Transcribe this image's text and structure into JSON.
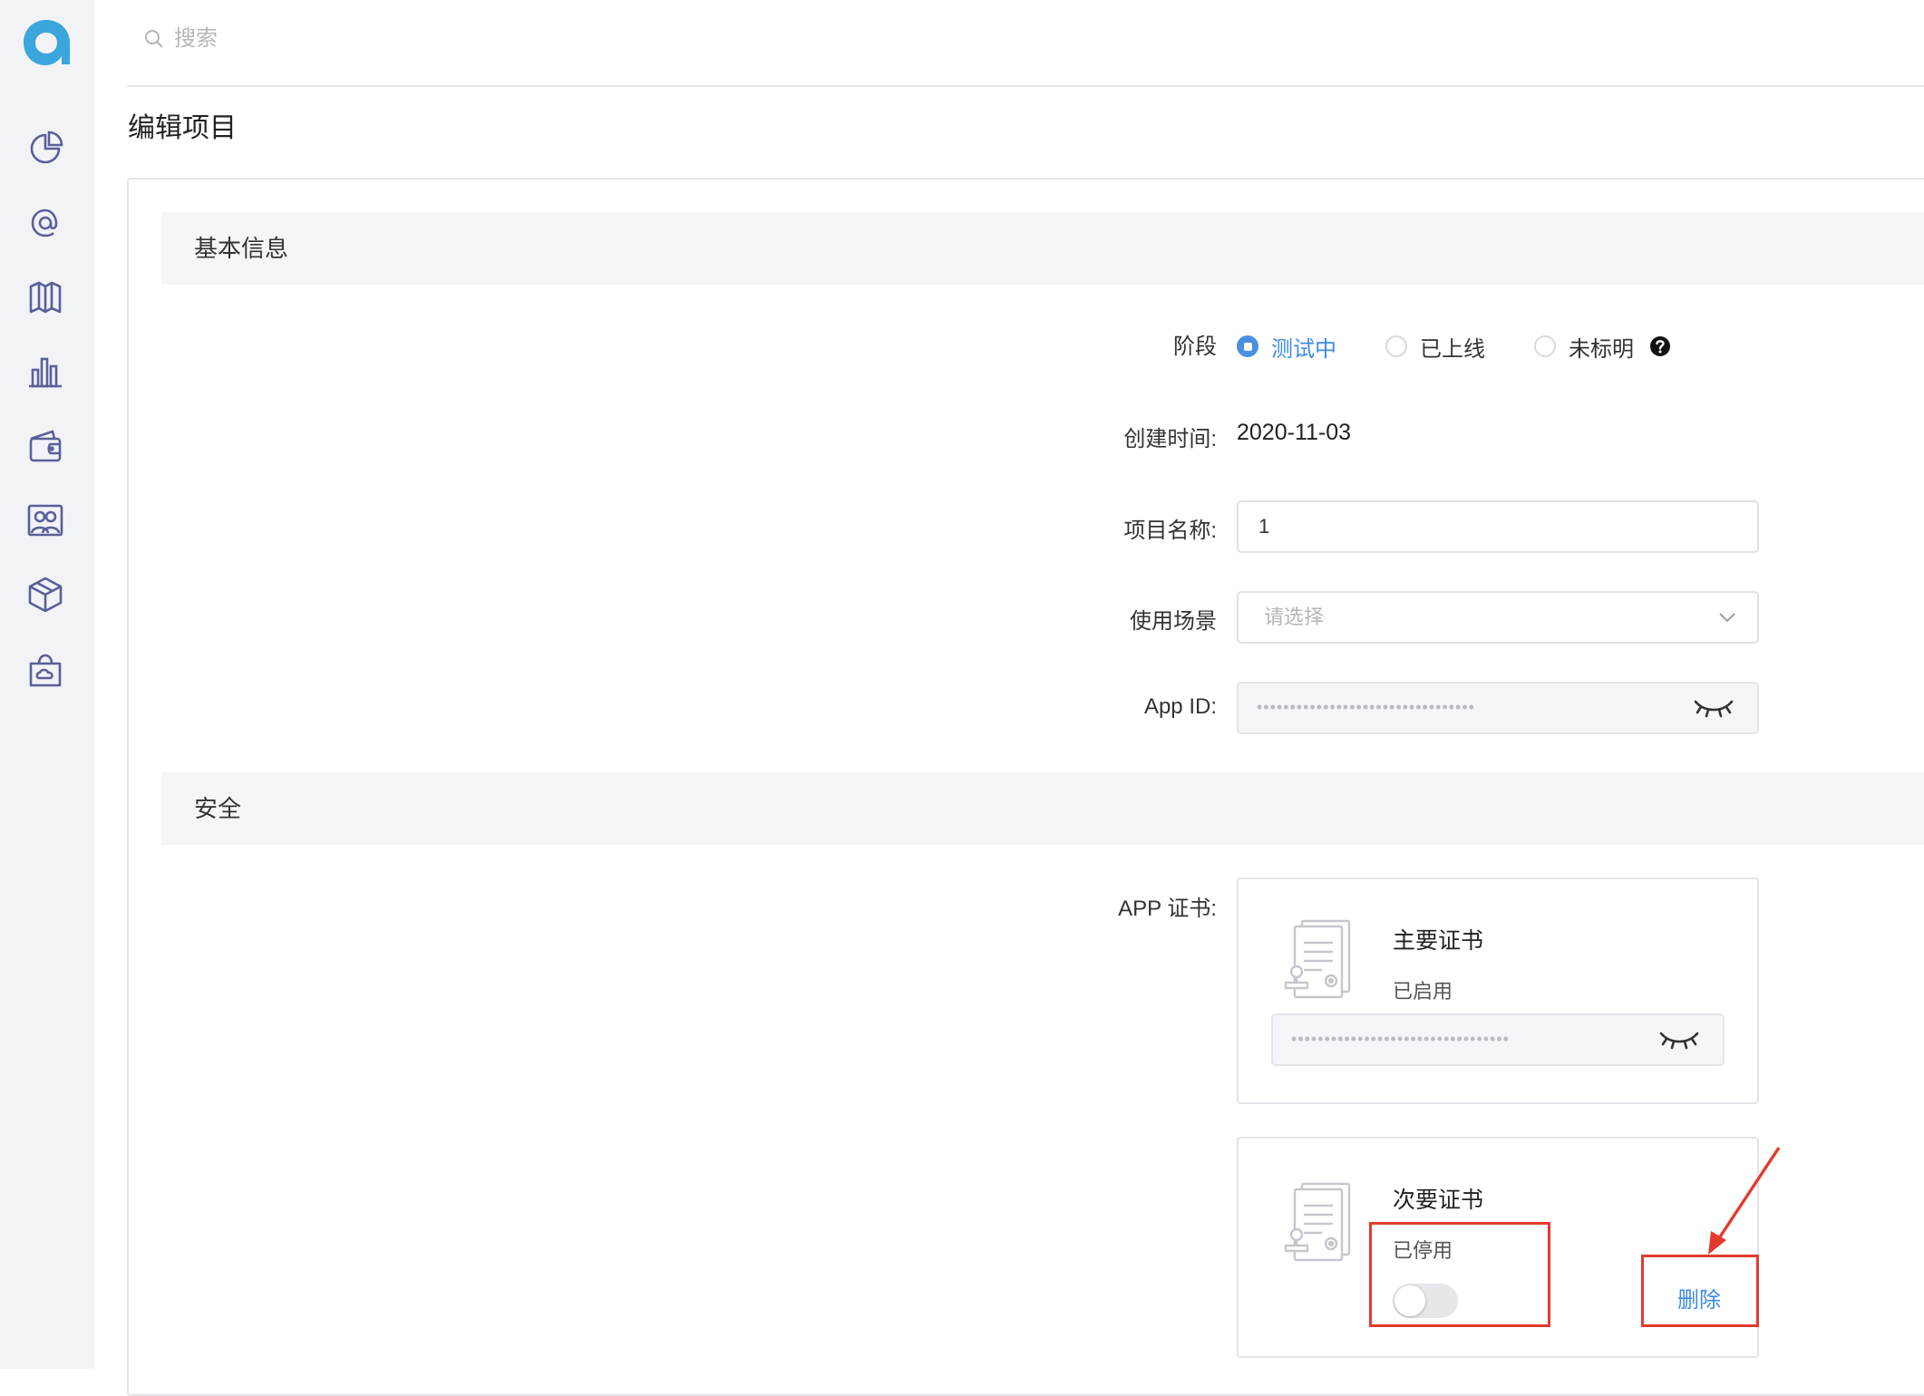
{
  "search": {
    "placeholder": "搜索"
  },
  "page": {
    "title": "编辑项目"
  },
  "basic_info": {
    "section_title": "基本信息",
    "stage": {
      "label": "阶段",
      "options": [
        {
          "label": "测试中",
          "selected": true
        },
        {
          "label": "已上线",
          "selected": false
        },
        {
          "label": "未标明",
          "selected": false
        }
      ]
    },
    "created": {
      "label": "创建时间:",
      "value": "2020-11-03"
    },
    "project_name": {
      "label": "项目名称:",
      "value": "1"
    },
    "usage_scene": {
      "label": "使用场景",
      "placeholder": "请选择"
    },
    "app_id": {
      "label": "App ID:",
      "masked": "•••••••••••••••••••••••••••••••••"
    }
  },
  "security": {
    "section_title": "安全",
    "cert_label": "APP 证书:",
    "primary_cert": {
      "title": "主要证书",
      "status": "已启用",
      "masked": "•••••••••••••••••••••••••••••••••"
    },
    "secondary_cert": {
      "title": "次要证书",
      "status": "已停用",
      "enabled": false,
      "delete_label": "删除"
    }
  },
  "colors": {
    "accent": "#3d8ae3",
    "sidebar_bg": "#f2f3f7",
    "section_bg": "#f5f6f8",
    "annotation": "#e23b2e"
  }
}
